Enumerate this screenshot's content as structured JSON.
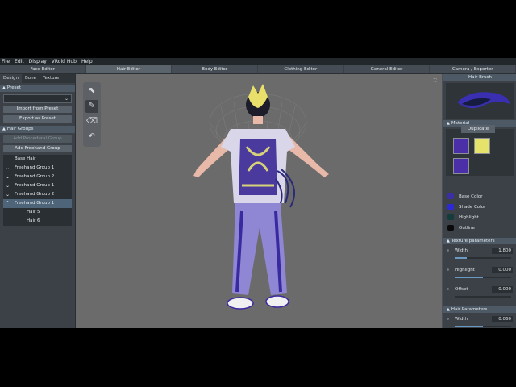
{
  "menu": [
    "File",
    "Edit",
    "Display",
    "VRoid Hub",
    "Help"
  ],
  "editor_tabs": [
    "Face Editor",
    "Hair Editor",
    "Body Editor",
    "Clothing Editor",
    "General Editor",
    "Camera / Exporter"
  ],
  "active_editor": 1,
  "left": {
    "subtabs": [
      "Design",
      "Bone",
      "Texture"
    ],
    "preset_header": "Preset",
    "import_label": "Import from Preset",
    "export_label": "Export as Preset",
    "hair_groups_header": "Hair Groups",
    "add_procedural_label": "Add Procedural Group",
    "add_freehand_label": "Add Freehand Group",
    "groups": [
      {
        "label": "Base Hair",
        "chev": ""
      },
      {
        "label": "Freehand Group 1",
        "chev": "✓"
      },
      {
        "label": "Freehand Group 2",
        "chev": "✓"
      },
      {
        "label": "Freehand Group 1",
        "chev": "✓"
      },
      {
        "label": "Freehand Group 2",
        "chev": "✓"
      },
      {
        "label": "Freehand Group 1",
        "chev": "^",
        "selected": true
      },
      {
        "label": "Hair 5",
        "child": true
      },
      {
        "label": "Hair 6",
        "child": true
      }
    ]
  },
  "right": {
    "title": "Hair Brush",
    "material_header": "Material",
    "duplicate_label": "Duplicate",
    "colors": [
      {
        "label": "Base Color",
        "hex": "#3b2fa3"
      },
      {
        "label": "Shade Color",
        "hex": "#2c2ad6"
      },
      {
        "label": "Highlight",
        "hex": "#143c3a"
      },
      {
        "label": "Outline",
        "hex": "#0a0a0a"
      }
    ],
    "swatches": [
      "#4a2fa8",
      "#e6e36a",
      "#4a2fa8"
    ],
    "texture_header": "Texture parameters",
    "texture_params": [
      {
        "label": "Width",
        "value": "1.800",
        "fraction": 0.22
      },
      {
        "label": "Highlight",
        "value": "0.000",
        "fraction": 0.5
      },
      {
        "label": "Offset",
        "value": "0.000",
        "fraction": 0.0
      }
    ],
    "hair_params_header": "Hair Parameters",
    "hair_params": [
      {
        "label": "Width",
        "value": "0.060",
        "fraction": 0.5
      }
    ]
  },
  "colors": {
    "accent": "#6a9ac4",
    "panel": "#3b4147",
    "viewport": "#6b6b6b",
    "header": "#4d5a66"
  }
}
